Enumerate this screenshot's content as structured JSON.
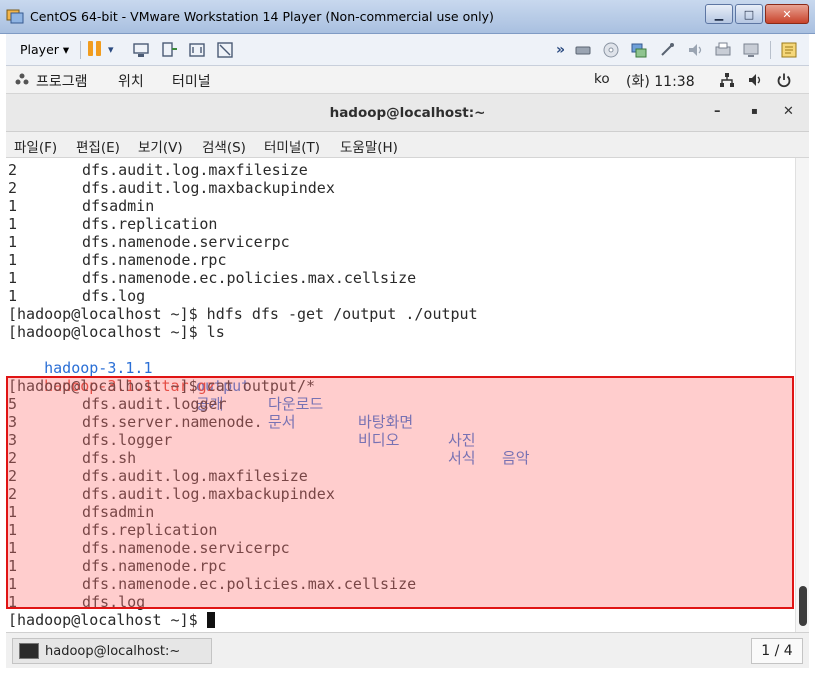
{
  "vm_window": {
    "title": "CentOS 64-bit - VMware Workstation 14 Player (Non-commercial use only)",
    "minimize": "▁",
    "maximize": "□",
    "close": "✕"
  },
  "vm_toolbar": {
    "player_menu": "Player ▾",
    "dropdown_arrow": "▾",
    "chevron": "»"
  },
  "gnome_bar": {
    "applications": "프로그램",
    "places": "위치",
    "terminal": "터미널",
    "input_method": "ko",
    "clock": "(화) 11:38"
  },
  "terminal": {
    "title": "hadoop@localhost:~",
    "controls": {
      "minimize": "–",
      "maximize": "▪",
      "close": "✕"
    },
    "menu": [
      "파일(F)",
      "편집(E)",
      "보기(V)",
      "검색(S)",
      "터미널(T)",
      "도움말(H)"
    ],
    "lines": [
      {
        "count": "2",
        "text": "dfs.audit.log.maxfilesize"
      },
      {
        "count": "2",
        "text": "dfs.audit.log.maxbackupindex"
      },
      {
        "count": "1",
        "text": "dfsadmin"
      },
      {
        "count": "1",
        "text": "dfs.replication"
      },
      {
        "count": "1",
        "text": "dfs.namenode.servicerpc"
      },
      {
        "count": "1",
        "text": "dfs.namenode.rpc"
      },
      {
        "count": "1",
        "text": "dfs.namenode.ec.policies.max.cellsize"
      },
      {
        "count": "1",
        "text": "dfs.log"
      }
    ],
    "prompt_get": "[hadoop@localhost ~]$ hdfs dfs -get /output ./output",
    "prompt_ls": "[hadoop@localhost ~]$ ls",
    "ls_row1": [
      "hadoop-3.1.1",
      "output",
      "다운로드",
      "바탕화면",
      "사진",
      "음악"
    ],
    "ls_row2": [
      "hadoop-3.1.1.tar.gz",
      "공개",
      "문서",
      "비디오",
      "서식"
    ],
    "prompt_cat": "[hadoop@localhost ~]$ cat output/*",
    "cat_lines": [
      {
        "count": "5",
        "text": "dfs.audit.logger"
      },
      {
        "count": "3",
        "text": "dfs.server.namenode."
      },
      {
        "count": "3",
        "text": "dfs.logger"
      },
      {
        "count": "2",
        "text": "dfs.sh"
      },
      {
        "count": "2",
        "text": "dfs.audit.log.maxfilesize"
      },
      {
        "count": "2",
        "text": "dfs.audit.log.maxbackupindex"
      },
      {
        "count": "1",
        "text": "dfsadmin"
      },
      {
        "count": "1",
        "text": "dfs.replication"
      },
      {
        "count": "1",
        "text": "dfs.namenode.servicerpc"
      },
      {
        "count": "1",
        "text": "dfs.namenode.rpc"
      },
      {
        "count": "1",
        "text": "dfs.namenode.ec.policies.max.cellsize"
      },
      {
        "count": "1",
        "text": "dfs.log"
      }
    ],
    "final_prompt": "[hadoop@localhost ~]$ "
  },
  "taskbar": {
    "task_label": "hadoop@localhost:~",
    "workspace": "1 / 4"
  },
  "colors": {
    "highlight_border": "#e01414",
    "highlight_fill": "#ffb8b8",
    "ls_directory": "#2a6fd6",
    "ls_archive": "#d6372a"
  }
}
